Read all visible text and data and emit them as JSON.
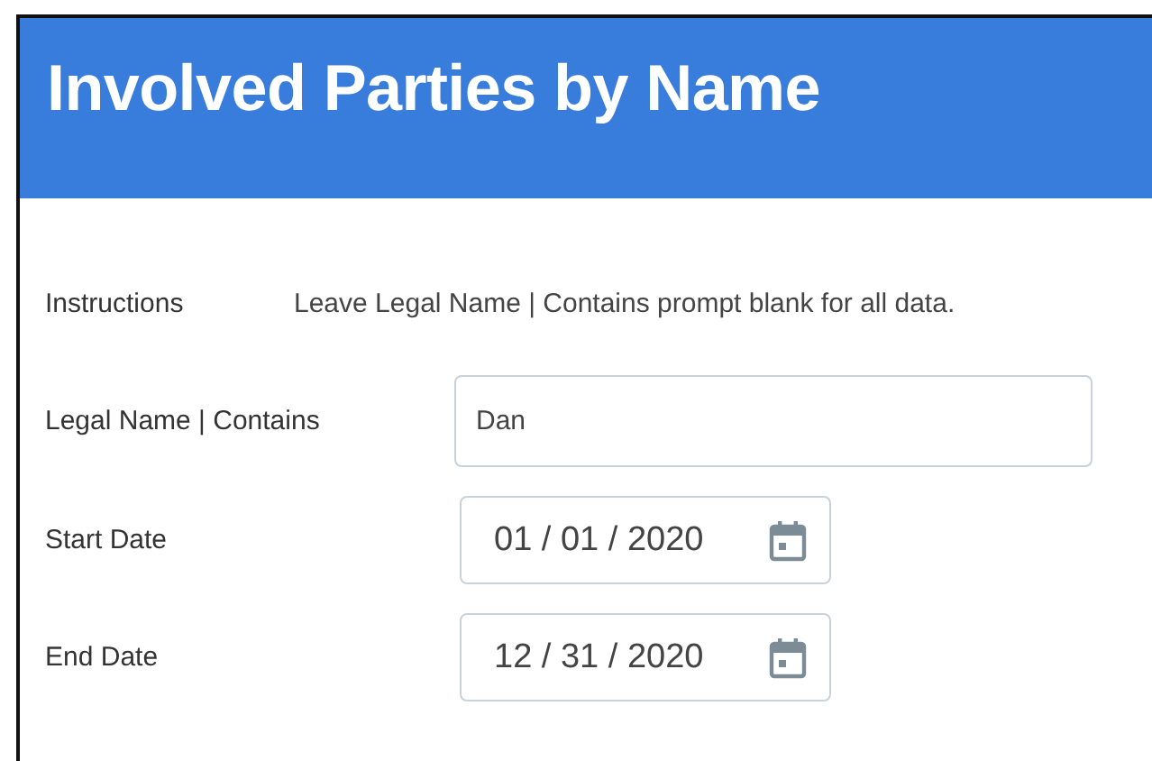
{
  "header": {
    "title": "Involved Parties by Name"
  },
  "instructions": {
    "label": "Instructions",
    "text": "Leave Legal Name | Contains prompt blank for all data."
  },
  "fields": [
    {
      "kind": "text",
      "label": "Legal Name | Contains",
      "value": "Dan"
    },
    {
      "kind": "date",
      "label": "Start Date",
      "value": "01 / 01 / 2020"
    },
    {
      "kind": "date",
      "label": "End Date",
      "value": "12 / 31 / 2020"
    }
  ]
}
